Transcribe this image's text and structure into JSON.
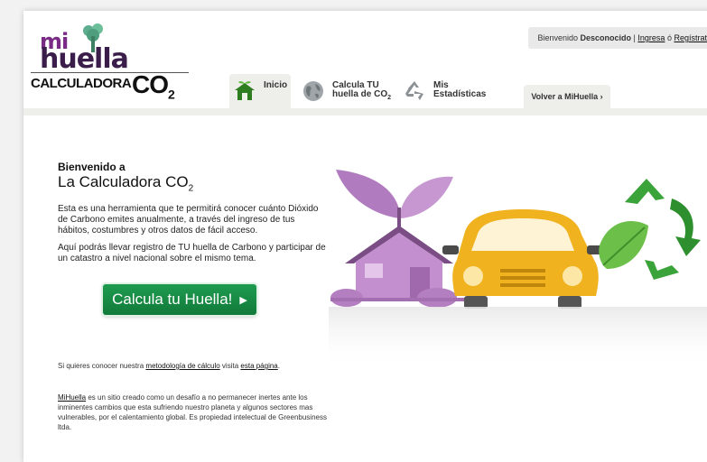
{
  "logo": {
    "mi": "mi",
    "huella": "huella",
    "calculadora": "CALCULADORA",
    "co": "CO",
    "two": "2"
  },
  "userbar": {
    "greeting": "Bienvenido",
    "user": "Desconocido",
    "separator": "|",
    "login": "Ingresa",
    "or": "ó",
    "register": "Regístrate"
  },
  "nav": {
    "home": "Inicio",
    "calc_line1": "Calcula TU",
    "calc_line2": "huella de CO",
    "calc_sub": "2",
    "stats_line1": "Mis",
    "stats_line2": "Estadísticas",
    "volver": "Volver a MiHuella ›"
  },
  "main": {
    "welcome_small": "Bienvenido a",
    "welcome_big": "La Calculadora CO",
    "welcome_sub": "2",
    "intro1": "Esta es una herramienta que te permitirá conocer cuánto Dióxido de Carbono emites anualmente, a través del ingreso de tus hábitos, costumbres y otros datos de fácil acceso.",
    "intro2": "Aquí podrás llevar registro de TU huella de Carbono y participar de un catastro a nivel nacional sobre el mismo tema.",
    "cta": "Calcula tu Huella!",
    "cta_arrow": "▶",
    "metodo_pre": "Si quieres conocer nuestra",
    "metodo_link": "metodología de cálculo",
    "metodo_mid": "visita",
    "metodo_link2": "esta página",
    "metodo_end": ".",
    "about_link": "MiHuella",
    "about_text": " es un sitio creado como un desafío a no permanecer inertes ante los inminentes cambios que esta sufriendo nuestro planeta y algunos sectores mas vulnerables, por el calentamiento global. Es propiedad intelectual de Greenbusiness ltda."
  },
  "colors": {
    "accent_green": "#1e9b4f",
    "logo_purple": "#7a2b86",
    "house_purple": "#b07bbf",
    "car_yellow": "#f0b21e",
    "recycle_green": "#3aa33a"
  },
  "icons": [
    "tree-icon",
    "house-icon",
    "globe-icon",
    "recycle-icon"
  ]
}
